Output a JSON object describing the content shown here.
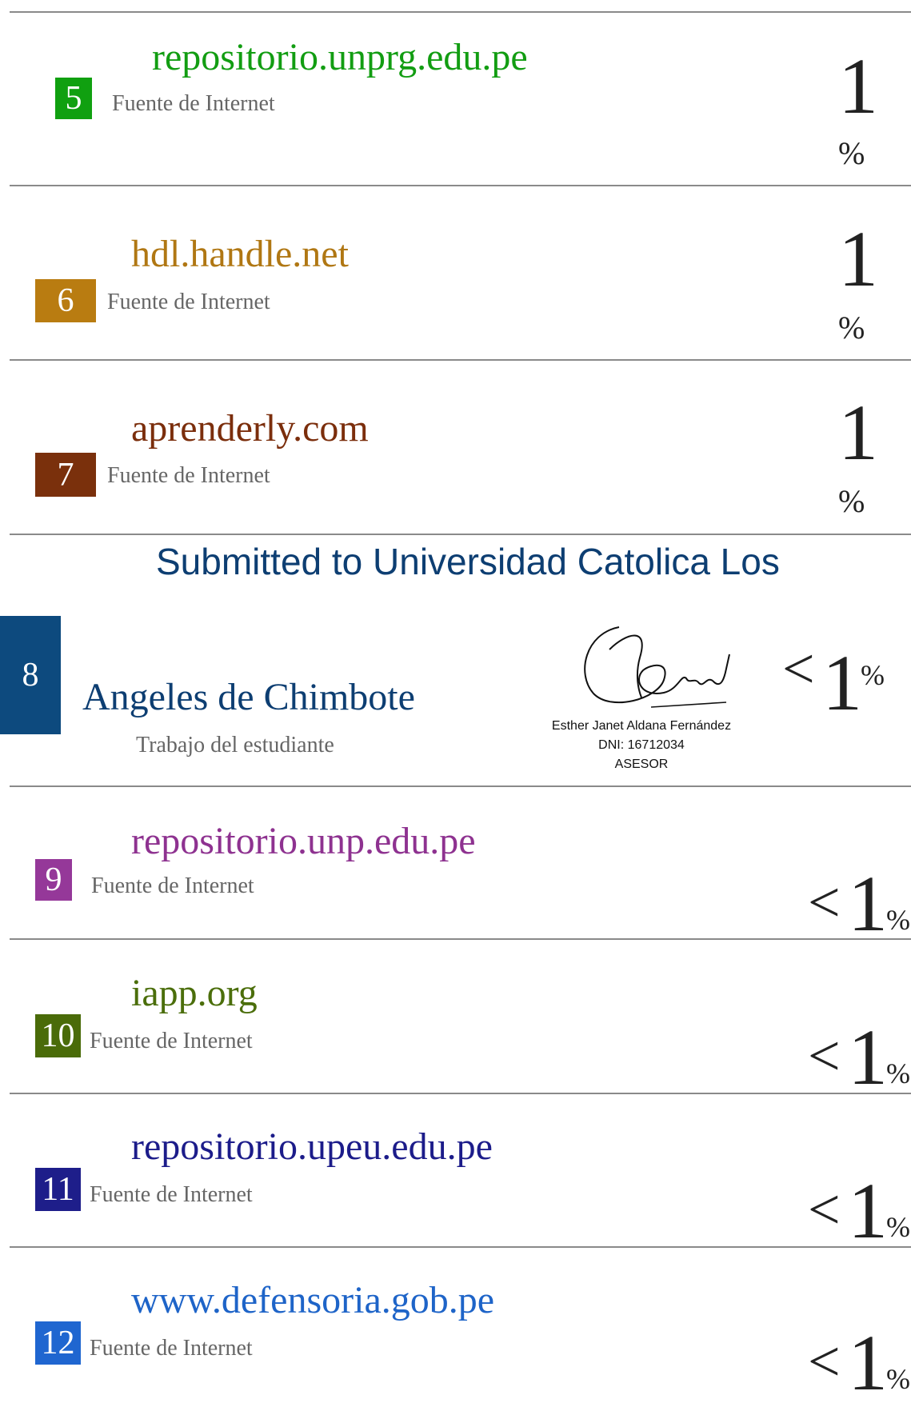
{
  "sources": [
    {
      "number": "5",
      "name": "repositorio.unprg.edu.pe",
      "type": "Fuente de Internet",
      "percent": "1",
      "percent_symbol": "%",
      "name_color": "#129d12",
      "box_color": "#10a010"
    },
    {
      "number": "6",
      "name": "hdl.handle.net",
      "type": "Fuente de Internet",
      "percent": "1",
      "percent_symbol": "%",
      "name_color": "#b07713",
      "box_color": "#b97c11"
    },
    {
      "number": "7",
      "name": "aprenderly.com",
      "type": "Fuente de Internet",
      "percent": "1",
      "percent_symbol": "%",
      "name_color": "#7b2e0c",
      "box_color": "#7a300c"
    },
    {
      "number": "8",
      "name_line1": "Submitted to Universidad Catolica Los",
      "name_line2": "Angeles de Chimbote",
      "type": "Trabajo del estudiante",
      "percent_prefix": "<",
      "percent": "1",
      "percent_symbol": "%",
      "name_color": "#0d3e72",
      "box_color": "#0d4a7e"
    },
    {
      "number": "9",
      "name": "repositorio.unp.edu.pe",
      "type": "Fuente de Internet",
      "percent_prefix": "<",
      "percent": "1",
      "percent_symbol": "%",
      "name_color": "#8e3290",
      "box_color": "#953899"
    },
    {
      "number": "10",
      "name": "iapp.org",
      "type": "Fuente de Internet",
      "percent_prefix": "<",
      "percent": "1",
      "percent_symbol": "%",
      "name_color": "#4b6e0b",
      "box_color": "#4a6b09"
    },
    {
      "number": "11",
      "name": "repositorio.upeu.edu.pe",
      "type": "Fuente de Internet",
      "percent_prefix": "<",
      "percent": "1",
      "percent_symbol": "%",
      "name_color": "#1c1c8a",
      "box_color": "#1e1e8a"
    },
    {
      "number": "12",
      "name": "www.defensoria.gob.pe",
      "type": "Fuente de Internet",
      "percent_prefix": "<",
      "percent": "1",
      "percent_symbol": "%",
      "name_color": "#1e64c8",
      "box_color": "#1f66d0"
    }
  ],
  "signature": {
    "name": "Esther Janet Aldana Fernández",
    "dni": "DNI: 16712034",
    "role": "ASESOR"
  }
}
